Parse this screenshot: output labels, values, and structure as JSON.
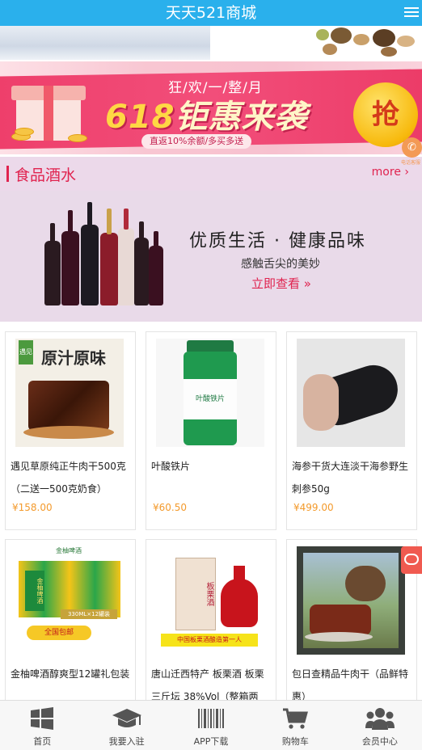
{
  "header": {
    "title": "天天521商城"
  },
  "promo": {
    "top_text": "狂/欢/一/整/月",
    "num": "618",
    "main_text": "钜惠来袭",
    "sub_text": "直返10%余额/多买多送",
    "grab_label": "抢",
    "phone_caption": "电话客服"
  },
  "section": {
    "title": "食品酒水",
    "more": "more ›"
  },
  "wine_banner": {
    "title": "优质生活 · 健康品味",
    "subtitle": "感触舌尖的美妙",
    "cta": "立即查看 »"
  },
  "products": [
    {
      "name": "遇见草原纯正牛肉干500克（二送一500克奶食）",
      "price": "¥158.00",
      "badge": "原汁原味",
      "tag": "遇见"
    },
    {
      "name": "叶酸铁片",
      "price": "¥60.50",
      "label": "叶酸铁片"
    },
    {
      "name": "海参干货大连淡干海参野生刺参50g",
      "price": "¥499.00"
    },
    {
      "name": "金柚啤酒醇爽型12罐礼包装",
      "price": "",
      "brand": "金柚啤酒",
      "spec": "330ML×12罐装",
      "shipping": "全国包邮",
      "beer_text": "金柚啤酒"
    },
    {
      "name": "唐山迁西特产 板栗酒 板栗三斤坛 38%Vol（整箱两",
      "price": "",
      "jar_text": "板栗酒",
      "banner": "中国板栗酒酿造第一人"
    },
    {
      "name": "包日查精品牛肉干（品鲜特惠）",
      "price": ""
    }
  ],
  "bottom_nav": [
    {
      "label": "首页",
      "icon": "windows-icon"
    },
    {
      "label": "我要入驻",
      "icon": "graduation-cap-icon"
    },
    {
      "label": "APP下载",
      "icon": "barcode-icon"
    },
    {
      "label": "购物车",
      "icon": "cart-icon"
    },
    {
      "label": "会员中心",
      "icon": "members-icon"
    }
  ]
}
